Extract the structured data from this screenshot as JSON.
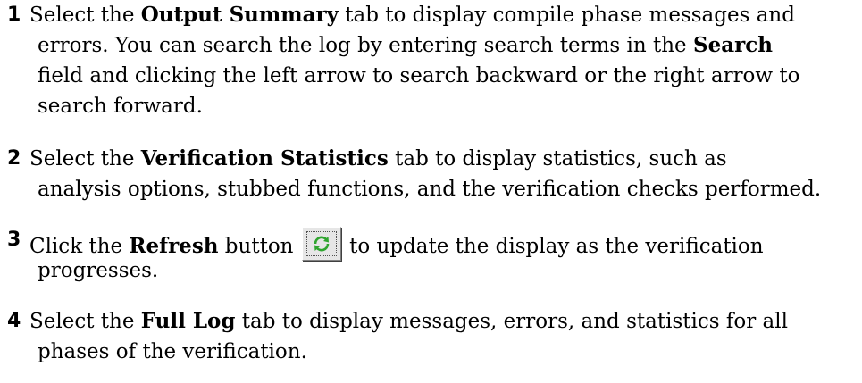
{
  "steps": [
    {
      "number": "1",
      "lines": [
        {
          "pre": "Select the ",
          "bold": "Output Summary",
          "post": " tab to display compile phase messages and"
        },
        {
          "pre": "errors. You can search the log by entering search terms in the ",
          "bold": "Search",
          "post": ""
        },
        {
          "pre": "field and clicking the left arrow to search backward or the right arrow to",
          "bold": "",
          "post": ""
        },
        {
          "pre": "search forward.",
          "bold": "",
          "post": ""
        }
      ]
    },
    {
      "number": "2",
      "lines": [
        {
          "pre": "Select the ",
          "bold": "Verification Statistics",
          "post": " tab to display statistics, such as"
        },
        {
          "pre": "analysis options, stubbed functions, and the verification checks performed.",
          "bold": "",
          "post": ""
        }
      ]
    },
    {
      "number": "3",
      "lines": [
        {
          "pre": "Click the ",
          "bold": "Refresh",
          "post": " button",
          "after_icon": " to update the display as the verification"
        },
        {
          "pre": "progresses.",
          "bold": "",
          "post": ""
        }
      ]
    },
    {
      "number": "4",
      "lines": [
        {
          "pre": "Select the ",
          "bold": "Full Log",
          "post": " tab to display messages, errors, and statistics for all"
        },
        {
          "pre": "phases of the verification.",
          "bold": "",
          "post": ""
        }
      ]
    }
  ],
  "icons": {
    "refresh": "refresh-icon"
  },
  "colors": {
    "refresh_arrows": "#2fa52f",
    "button_face": "#e6e6e6"
  }
}
